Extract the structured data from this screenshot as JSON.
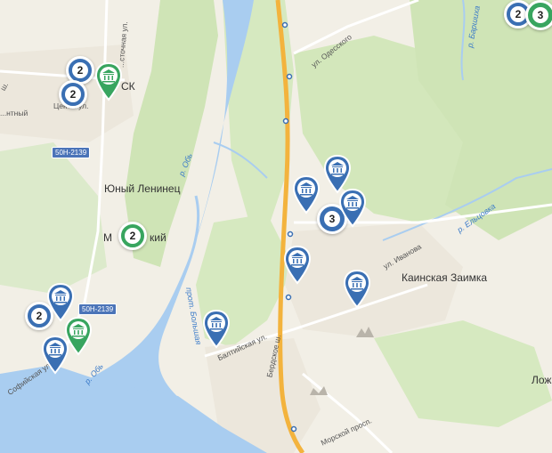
{
  "labels": {
    "yuny_leninets": "Юный Ленинец",
    "kainskaya_zaimka": "Каинская Заимка",
    "mikhaylovsky_partial": "М",
    "mikhaylovsky_end": "кий",
    "ob_river_1": "р. Обь",
    "ob_river_2": "р. Обь",
    "elcovka": "р. Ельцовка",
    "barishikha": "р. Баршиха",
    "protok_bolshaya": "прот. Большая",
    "tsentr_ul": "Цент... ул.",
    "vostochnaya_ul": "...сточная ул.",
    "sk_fragment": "СК",
    "odesskaya_ul": "ул. Одесского",
    "ivanova_ul": "ул. Иванова",
    "baltiyskaya_ul": "Балтийская ул.",
    "berdskoe_sh": "Бердское ш.",
    "morskoy_prosp": "Морской просп.",
    "sofiyskaya_ul": "Софийская ул.",
    "lozh_fragment": "Лож",
    "ntny_fragment": "...нтный",
    "sh_fragment": "ш.",
    "highway_1": "50Н-2139",
    "highway_2": "50Н-2139"
  },
  "clusters": [
    {
      "count": "2",
      "color": "blue"
    },
    {
      "count": "2",
      "color": "blue"
    },
    {
      "count": "2",
      "color": "green"
    },
    {
      "count": "3",
      "color": "blue"
    },
    {
      "count": "2",
      "color": "blue"
    },
    {
      "count": "3",
      "color": "green"
    }
  ],
  "colors": {
    "water": "#a9cdf0",
    "forest": "#cfe4b6",
    "urban": "#ece7dc",
    "highway": "#f3b33d",
    "pin_blue": "#3a6fb3",
    "pin_green": "#38a55f"
  },
  "pin_icon": "museum-icon"
}
